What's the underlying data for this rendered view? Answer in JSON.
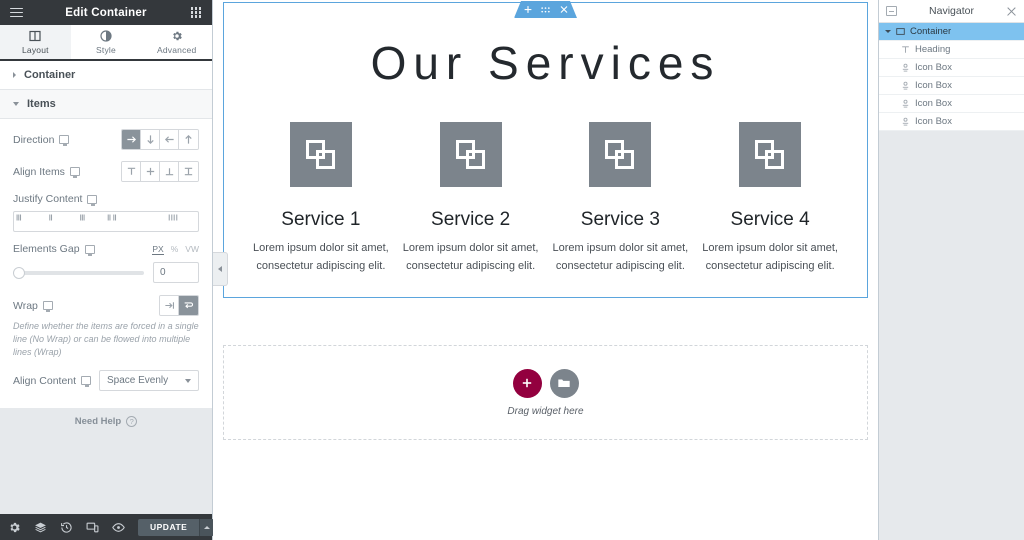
{
  "panel": {
    "title": "Edit Container",
    "menu_icon": "hamburger-icon",
    "widgets_icon": "widgets-grid-icon",
    "tabs": [
      {
        "label": "Layout",
        "icon": "layout-columns-icon",
        "active": true
      },
      {
        "label": "Style",
        "icon": "contrast-circle-icon",
        "active": false
      },
      {
        "label": "Advanced",
        "icon": "gear-icon",
        "active": false
      }
    ],
    "sections": [
      {
        "label": "Container",
        "expanded": false
      },
      {
        "label": "Items",
        "expanded": true
      }
    ],
    "controls": {
      "direction": {
        "label": "Direction",
        "options": [
          "row",
          "column",
          "row-reverse",
          "column-reverse"
        ],
        "selected_index": 0
      },
      "align_items": {
        "label": "Align Items",
        "options": [
          "flex-start",
          "center",
          "flex-end",
          "stretch"
        ],
        "selected_index": -1
      },
      "justify_content": {
        "label": "Justify Content",
        "options": [
          "flex-start",
          "center",
          "flex-end",
          "space-between",
          "space-around",
          "space-evenly"
        ],
        "selected_index": 4
      },
      "elements_gap": {
        "label": "Elements Gap",
        "value": "0",
        "units": [
          "PX",
          "%",
          "VW"
        ],
        "selected_unit": "PX",
        "slider_percent": 0
      },
      "wrap": {
        "label": "Wrap",
        "options": [
          "nowrap",
          "wrap"
        ],
        "selected_index": 1,
        "description": "Define whether the items are forced in a single line (No Wrap) or can be flowed into multiple lines (Wrap)"
      },
      "align_content": {
        "label": "Align Content",
        "value": "Space Evenly"
      }
    },
    "need_help": "Need Help",
    "footer": {
      "icons": [
        "settings-gear-icon",
        "navigator-layers-icon",
        "history-clock-icon",
        "responsive-mode-icon",
        "preview-eye-icon"
      ],
      "update_label": "UPDATE"
    },
    "collapse_icon": "chevron-left-icon"
  },
  "canvas": {
    "element_toolbar": {
      "add_icon": "plus-icon",
      "drag_icon": "drag-handle-icon",
      "close_icon": "close-x-icon"
    },
    "heading": "Our Services",
    "services": [
      {
        "icon": "clone-squares-icon",
        "title": "Service 1",
        "description": "Lorem ipsum dolor sit amet, consectetur adipiscing elit."
      },
      {
        "icon": "clone-squares-icon",
        "title": "Service 2",
        "description": "Lorem ipsum dolor sit amet, consectetur adipiscing elit."
      },
      {
        "icon": "clone-squares-icon",
        "title": "Service 3",
        "description": "Lorem ipsum dolor sit amet, consectetur adipiscing elit."
      },
      {
        "icon": "clone-squares-icon",
        "title": "Service 4",
        "description": "Lorem ipsum dolor sit amet, consectetur adipiscing elit."
      }
    ],
    "dropzone": {
      "add_icon": "plus-icon",
      "folder_icon": "folder-icon",
      "text": "Drag widget here"
    }
  },
  "navigator": {
    "title": "Navigator",
    "dock_icon": "dock-toggle-icon",
    "close_icon": "close-x-icon",
    "items": [
      {
        "label": "Container",
        "icon": "container-icon",
        "selected": true,
        "child": false
      },
      {
        "label": "Heading",
        "icon": "heading-t-icon",
        "selected": false,
        "child": true
      },
      {
        "label": "Icon Box",
        "icon": "icon-box-icon",
        "selected": false,
        "child": true
      },
      {
        "label": "Icon Box",
        "icon": "icon-box-icon",
        "selected": false,
        "child": true
      },
      {
        "label": "Icon Box",
        "icon": "icon-box-icon",
        "selected": false,
        "child": true
      },
      {
        "label": "Icon Box",
        "icon": "icon-box-icon",
        "selected": false,
        "child": true
      }
    ]
  },
  "colors": {
    "accent_blue": "#5ba5dd",
    "nav_selected": "#7ec2ef",
    "add_button": "#93003f",
    "icon_gray": "#7c848c",
    "dark_bar": "#34383c"
  }
}
